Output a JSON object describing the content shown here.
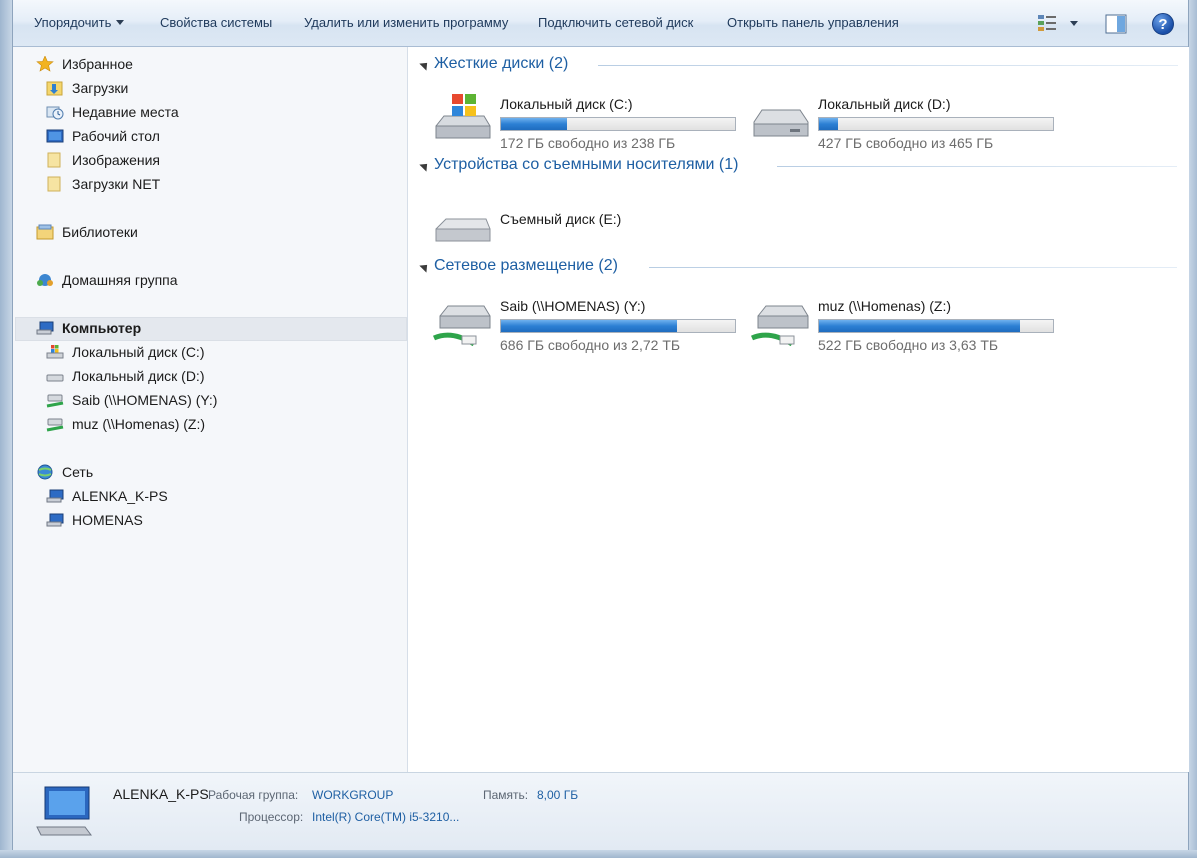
{
  "toolbar": {
    "organize": "Упорядочить",
    "system_properties": "Свойства системы",
    "uninstall": "Удалить или изменить программу",
    "map_drive": "Подключить сетевой диск",
    "control_panel": "Открыть панель управления",
    "icons": {
      "view": "view-options-icon",
      "preview": "preview-pane-icon",
      "help": "help-icon"
    },
    "help_glyph": "?"
  },
  "nav": {
    "favorites": "Избранное",
    "downloads": "Загрузки",
    "recent": "Недавние места",
    "desktop": "Рабочий стол",
    "images": "Изображения",
    "downloads_net": "Загрузки NET",
    "libraries": "Библиотеки",
    "homegroup": "Домашняя группа",
    "computer": "Компьютер",
    "drive_c": "Локальный диск (C:)",
    "drive_d": "Локальный диск (D:)",
    "drive_y": "Saib (\\\\HOMENAS) (Y:)",
    "drive_z": "muz (\\\\Homenas) (Z:)",
    "network": "Сеть",
    "net_pc1": "ALENKA_K-PS",
    "net_pc2": "HOMENAS"
  },
  "groups": {
    "hdd": "Жесткие диски (2)",
    "removable": "Устройства со съемными носителями (1)",
    "network": "Сетевое размещение (2)"
  },
  "drives": {
    "c": {
      "name": "Локальный диск (C:)",
      "free": "172 ГБ свободно из 238 ГБ",
      "used_fraction": 0.28
    },
    "d": {
      "name": "Локальный диск (D:)",
      "free": "427 ГБ свободно из 465 ГБ",
      "used_fraction": 0.08
    },
    "e": {
      "name": "Съемный диск (E:)"
    },
    "y": {
      "name": "Saib (\\\\HOMENAS) (Y:)",
      "free": "686 ГБ свободно из 2,72 ТБ",
      "used_fraction": 0.75
    },
    "z": {
      "name": "muz (\\\\Homenas) (Z:)",
      "free": "522 ГБ свободно из 3,63 ТБ",
      "used_fraction": 0.86
    }
  },
  "details": {
    "computer_name": "ALENKA_K-PS",
    "workgroup_label": "Рабочая группа:",
    "workgroup": "WORKGROUP",
    "memory_label": "Память:",
    "memory": "8,00 ГБ",
    "cpu_label": "Процессор:",
    "cpu": "Intel(R) Core(TM) i5-3210..."
  },
  "colors": {
    "accent": "#1e5fa3",
    "bar_fill": "#2c80d4"
  }
}
